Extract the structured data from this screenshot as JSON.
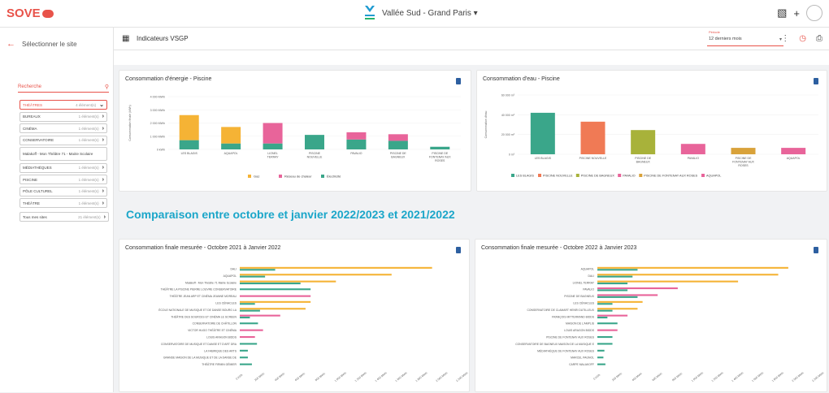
{
  "app": {
    "logo": "SOVE",
    "site_name": "Vallée Sud - Grand Paris",
    "site_dropdown": "▾"
  },
  "sidebar": {
    "back_label": "Sélectionner le site",
    "search_placeholder": "Recherche",
    "items": [
      {
        "label": "THÉÂTRES",
        "count": "4 élément(s)",
        "active": true
      },
      {
        "label": "BUREAUX",
        "count": "1 élément(s)"
      },
      {
        "label": "CINÉMA",
        "count": "1 élément(s)"
      },
      {
        "label": "CONSERVATOIRE",
        "count": "1 élément(s)"
      },
      {
        "label": "Malakoff - Mon Théâtre 71 - Mairie Scolaire",
        "count": "",
        "tall": true
      },
      {
        "label": "MÉDIATHÈQUES",
        "count": "1 élément(s)"
      },
      {
        "label": "PISCINE",
        "count": "1 élément(s)"
      },
      {
        "label": "PÔLE CULTUREL",
        "count": "1 élément(s)"
      },
      {
        "label": "THÉÂTRE",
        "count": "1 élément(s)"
      }
    ],
    "all_sites": {
      "label": "Tous mes sites",
      "count": "21 élément(s)"
    }
  },
  "subbar": {
    "title": "Indicateurs VSGP",
    "period_label": "Période",
    "period_value": "12 derniers mois"
  },
  "colors": {
    "accent": "#e8534a",
    "teal_title": "#1ba6c9",
    "gaz": "#f5b335",
    "reseau": "#e8649a",
    "electricite": "#3aa68a"
  },
  "section_title": "Comparaison entre octobre et janvier 2022/2023 et 2021/2022",
  "chart_data": [
    {
      "type": "bar",
      "stacked": true,
      "title": "Consommation d'énergie - Piscine",
      "ylabel": "Consommation finale (kWh)",
      "categories": [
        "LES BLAGIS",
        "AQUAPOL",
        "LIONEL TERRAY",
        "PISCINE NOUVELLE",
        "PAVALIO",
        "PISCINE DE BAGNEUX",
        "PISCINE DE FONTENAY AUX ROSES"
      ],
      "yticks": [
        "0 kWh",
        "1 000 MWh",
        "2 000 MWh",
        "3 000 MWh",
        "4 000 MWh"
      ],
      "ylim": [
        0,
        4000
      ],
      "series": [
        {
          "name": "Gaz",
          "color": "#f5b335",
          "values": [
            1900,
            1250,
            0,
            0,
            0,
            0,
            0
          ]
        },
        {
          "name": "Réseau de chaleur",
          "color": "#e8649a",
          "values": [
            0,
            0,
            1550,
            0,
            550,
            500,
            0
          ]
        },
        {
          "name": "Électricité",
          "color": "#3aa68a",
          "values": [
            700,
            450,
            450,
            1100,
            750,
            650,
            200
          ]
        }
      ]
    },
    {
      "type": "bar",
      "title": "Consommation d'eau - Piscine",
      "ylabel": "Consommation d'eau",
      "categories": [
        "LES BLAGIS",
        "PISCINE NOUVELLE",
        "PISCINE DE BAGNEUX",
        "PAVALIO",
        "PISCINE DE FONTENAY AUX ROSES",
        "AQUAPOL"
      ],
      "yticks": [
        "0 m³",
        "20 000 m³",
        "40 000 m³",
        "60 000 m³"
      ],
      "ylim": [
        0,
        60000
      ],
      "values": [
        42000,
        33000,
        24500,
        10500,
        6500,
        6500
      ],
      "colors": [
        "#3aa68a",
        "#f07a55",
        "#a8b23a",
        "#e8649a",
        "#d9a23a",
        "#e8649a"
      ],
      "legend": [
        "LES BLAGIS",
        "PISCINE NOUVELLE",
        "PISCINE DE BAGNEUX",
        "PAVALIO",
        "PISCINE DE FONTENAY AUX ROSES",
        "AQUAPOL"
      ]
    },
    {
      "type": "bar",
      "orientation": "horizontal",
      "title": "Consommation finale mesurée - Octobre 2021 à Janvier 2022",
      "categories": [
        "DALI",
        "AQUAPOL",
        "Malakoff - Mon Théâtre 71 Mairie Scolaire",
        "THÉÂTRE LA PISCINE PIERRE LOUVRE CONSERVATOIRE",
        "THÉÂTRE JEAN ARP ET CINÉMA JEANNE MOREAU",
        "LES CÉNACLES",
        "ÉCOLE NATIONALE DE MUSIQUE ET DE DANSE BOURG LA",
        "THÉÂTRE DES SOURCES ET CINÉMA LE SCREEN",
        "CONSERVATOIRE DE CHÂTILLON",
        "VICTOR HUGO THÉÂTRE ET CINÉMA",
        "LOUIS ARAGON BIDDS",
        "CONSERVATOIRE DE MUSIQUE ET DANSE ET D'ART DRA",
        "LA FABRIQUE DES ARTS",
        "GRANDE MAISON DE LA MUSIQUE ET DE LA DANSE DE",
        "THÉÂTRE FIRMIN GÉMIER"
      ],
      "series": [
        {
          "name": "Gaz",
          "color": "#f5b335",
          "values": [
            1900,
            1500,
            950,
            0,
            0,
            700,
            650,
            0,
            0,
            0,
            0,
            0,
            0,
            0,
            0
          ]
        },
        {
          "name": "Réseau de chaleur",
          "color": "#e8649a",
          "values": [
            0,
            0,
            0,
            0,
            700,
            0,
            0,
            400,
            0,
            230,
            150,
            0,
            0,
            0,
            0
          ]
        },
        {
          "name": "Électricité",
          "color": "#3aa68a",
          "values": [
            350,
            250,
            600,
            700,
            0,
            150,
            200,
            100,
            180,
            0,
            0,
            170,
            80,
            80,
            120
          ]
        }
      ],
      "xticks": [
        "0 kWh",
        "200 MWh",
        "400 MWh",
        "600 MWh",
        "800 MWh",
        "1 000 MWh",
        "1 200 MWh",
        "1 400 MWh",
        "1 600 MWh",
        "1 800 MWh",
        "2 000 MWh",
        "2 200 MWh"
      ],
      "xlim": [
        0,
        2200
      ]
    },
    {
      "type": "bar",
      "orientation": "horizontal",
      "title": "Consommation finale mesurée - Octobre 2022 à Janvier 2023",
      "categories": [
        "AQUAPOL",
        "DALI",
        "LIONEL TERRAY",
        "PAVALIO",
        "PISCINE DE BAGNEUX",
        "LES CÉNACLES",
        "CONSERVATOIRE DE CLAMART HENRI DUTILLEUX",
        "FRANÇOIS MITTERRAND BIDDS",
        "MAISON DE L'AMPLIS",
        "LOUIS ARAGON BIDDS",
        "PISCINE DE FONTENAY AUX ROSES",
        "CONSERVATOIRE DE BAGNEUX MAISON DE LA MUSIQUE E",
        "MÉDIATHÈQUE DE FONTENAY AUX ROSES",
        "MARCEL PAGNOL",
        "CARPE MALAKOFF"
      ],
      "series": [
        {
          "name": "Gaz",
          "color": "#f5b335",
          "values": [
            1900,
            1800,
            1400,
            0,
            0,
            450,
            400,
            0,
            0,
            0,
            0,
            0,
            0,
            0,
            0
          ]
        },
        {
          "name": "Réseau de chaleur",
          "color": "#e8649a",
          "values": [
            0,
            0,
            0,
            800,
            600,
            0,
            0,
            300,
            0,
            200,
            0,
            0,
            0,
            0,
            0
          ]
        },
        {
          "name": "Électricité",
          "color": "#3aa68a",
          "values": [
            400,
            350,
            300,
            300,
            400,
            150,
            150,
            100,
            200,
            0,
            150,
            150,
            70,
            60,
            80
          ]
        }
      ],
      "xticks": [
        "0 kWh",
        "200 MWh",
        "400 MWh",
        "600 MWh",
        "800 MWh",
        "1 000 MWh",
        "1 200 MWh",
        "1 400 MWh",
        "1 600 MWh",
        "1 800 MWh",
        "2 000 MWh",
        "2 200 MWh"
      ],
      "xlim": [
        0,
        2200
      ]
    }
  ]
}
